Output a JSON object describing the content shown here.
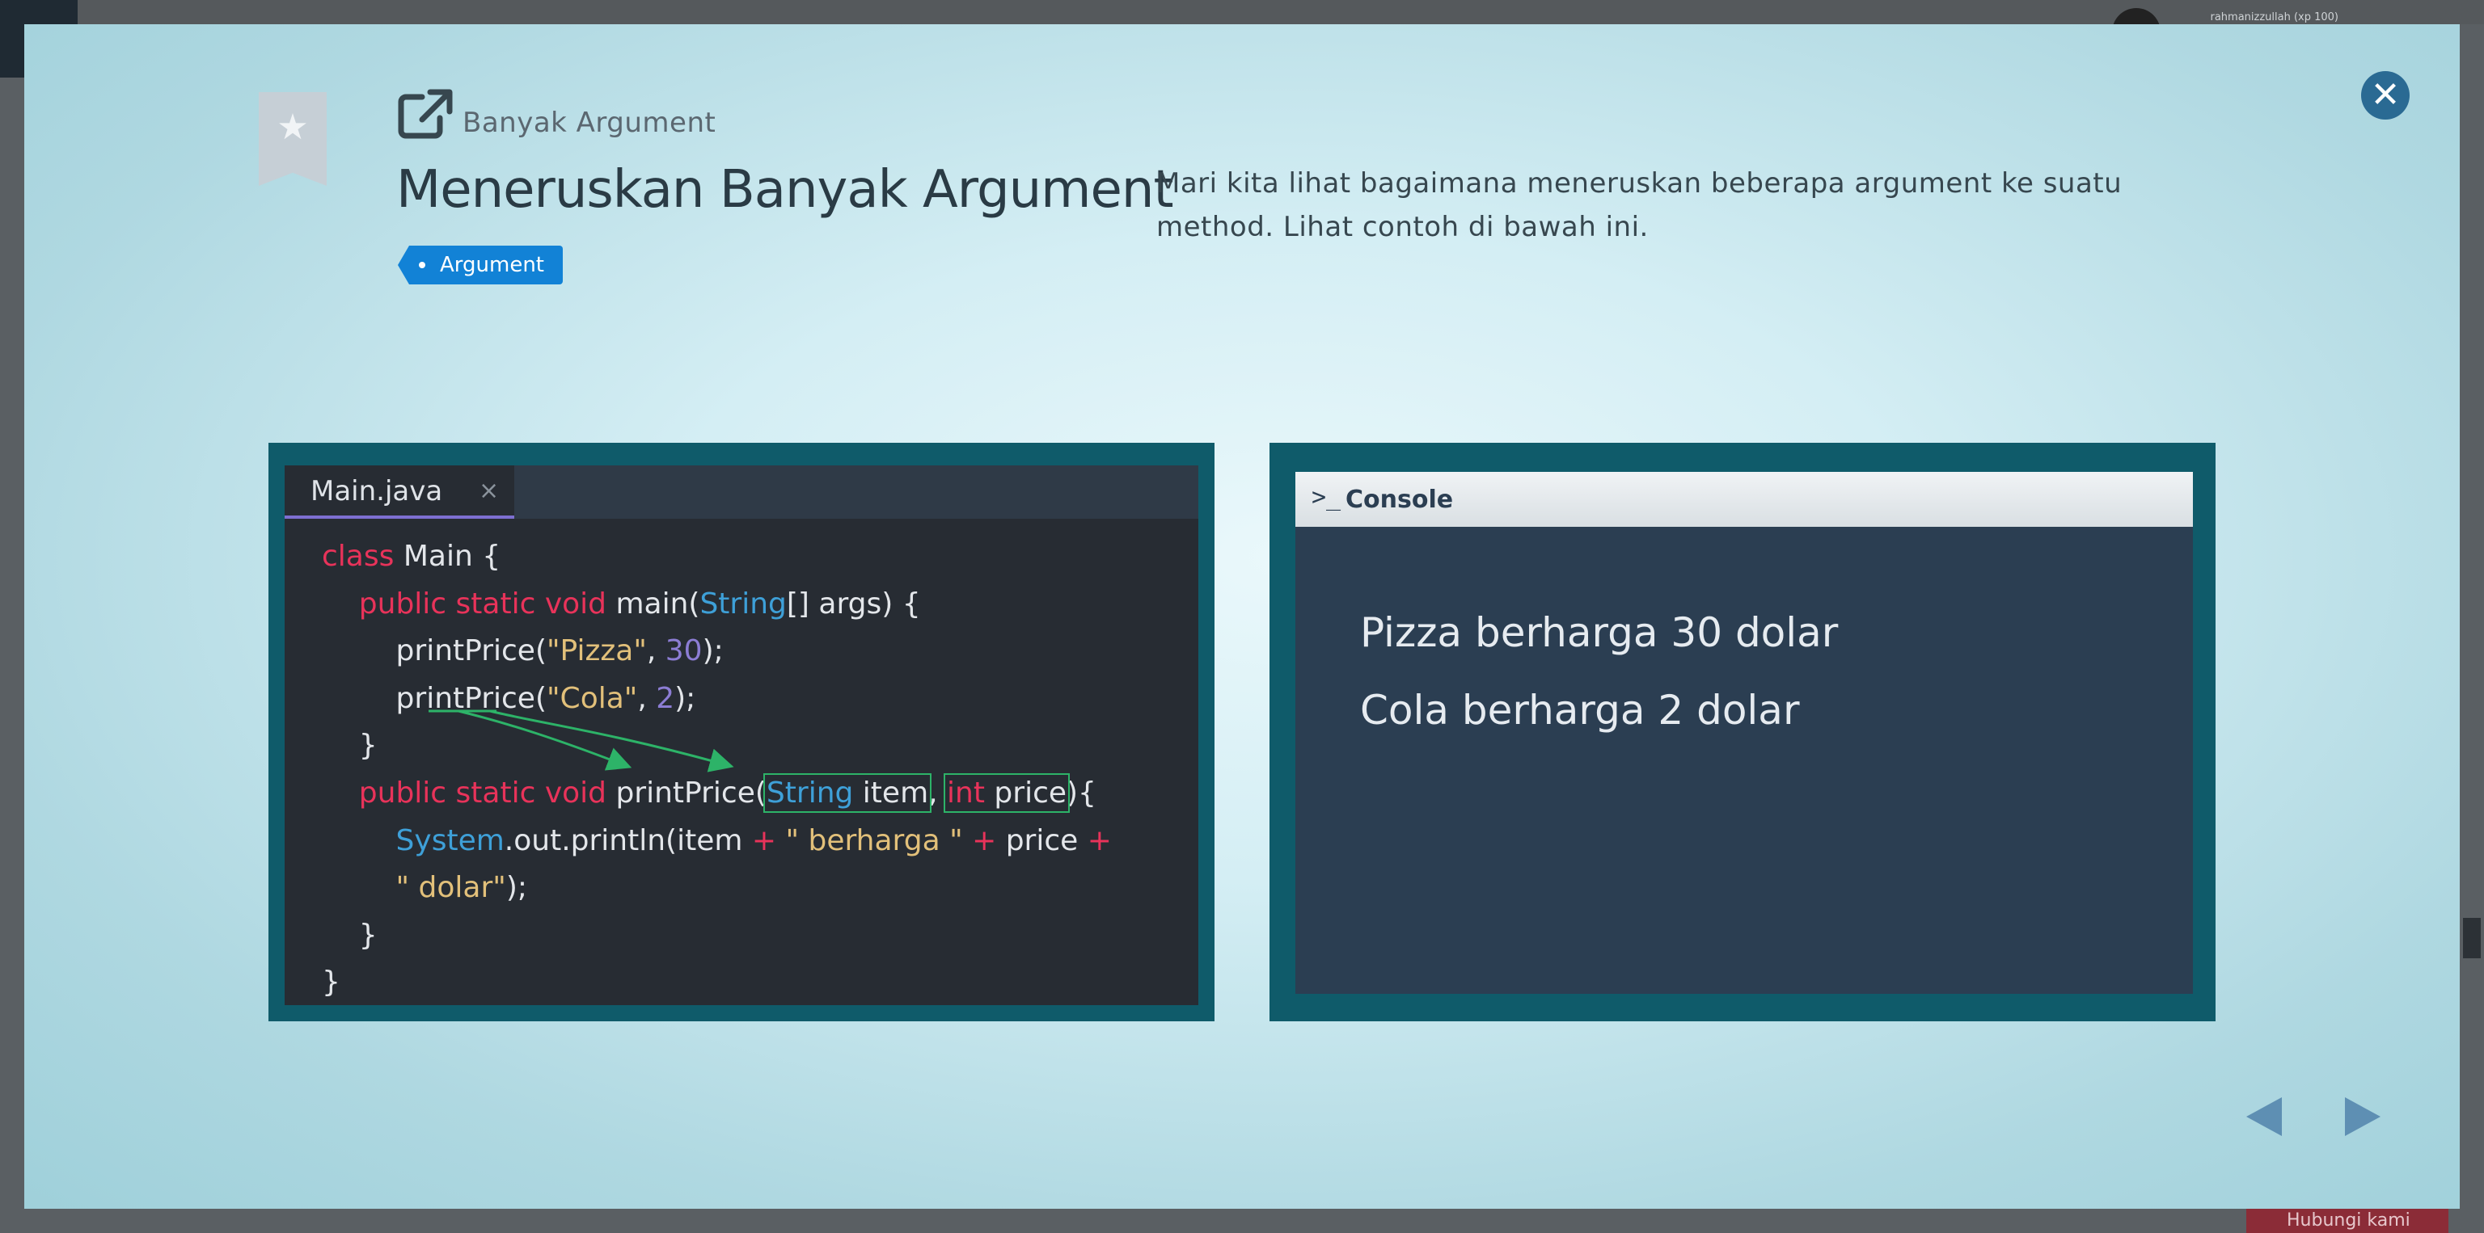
{
  "background": {
    "username": "rahmanizzullah (xp 100)",
    "footer_button": "Hubungi kami"
  },
  "lesson": {
    "subtitle": "Banyak Argument",
    "title": "Meneruskan Banyak Argument",
    "tag": "Argument",
    "description": "Mari kita lihat bagaimana meneruskan beberapa argument ke suatu method. Lihat contoh di bawah ini."
  },
  "editor": {
    "tab_label": "Main.java",
    "tab_close": "×",
    "code_lines": [
      "class Main {",
      "public static void main(String[] args) {",
      "printPrice(\"Pizza\", 30);",
      "printPrice(\"Cola\", 2);",
      "}",
      "public static void printPrice(String item, int price){",
      "System.out.println(item + \" berharga \" + price +",
      "\" dolar\");",
      "}",
      "}"
    ]
  },
  "console": {
    "title": "Console",
    "icon": "terminal-icon",
    "output": [
      "Pizza berharga 30 dolar",
      "Cola berharga 2 dolar"
    ]
  },
  "colors": {
    "keyword": "#e8335a",
    "type": "#3ea0d8",
    "string": "#e2c07a",
    "number": "#8c7dd4",
    "highlight_box": "#2db368",
    "tag_bg": "#1282d6",
    "close_button": "#2a6a93"
  },
  "navigation": {
    "prev_icon": "triangle-left-icon",
    "next_icon": "triangle-right-icon",
    "close_icon": "close-circle-icon"
  }
}
